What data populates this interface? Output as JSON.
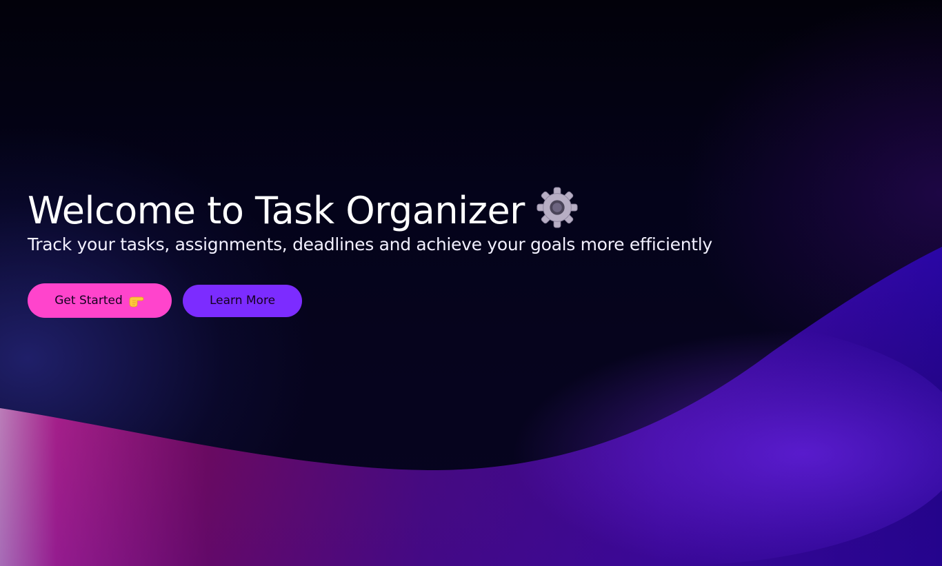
{
  "hero": {
    "title": "Welcome to Task Organizer",
    "subtitle": "Track your tasks, assignments, deadlines and achieve your goals more efficiently",
    "title_icon": "gear-icon",
    "primary_button": {
      "label": "Get Started",
      "icon": "pointing-hand-icon",
      "color": "#ff44cc"
    },
    "secondary_button": {
      "label": "Learn More",
      "color": "#7c2cff"
    }
  },
  "colors": {
    "background": "#03020f",
    "wave_purple": "#4a0fb8",
    "wave_magenta": "#c21a8a",
    "text": "#ffffff"
  }
}
